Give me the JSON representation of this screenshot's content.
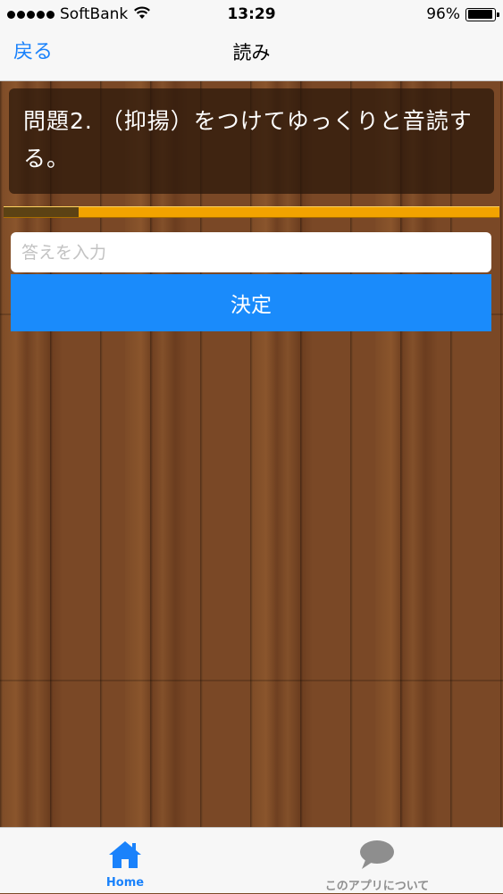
{
  "status_bar": {
    "carrier": "SoftBank",
    "time": "13:29",
    "battery": "96%",
    "battery_level": 0.96,
    "icons": [
      "signal-dots-icon",
      "wifi-icon",
      "battery-icon"
    ]
  },
  "nav": {
    "back_label": "戻る",
    "title": "読み"
  },
  "question": {
    "text": "問題2. （抑揚）をつけてゆっくりと音読する。"
  },
  "progress": {
    "fraction": 0.152
  },
  "answer": {
    "placeholder": "答えを入力",
    "value": ""
  },
  "submit": {
    "label": "決定"
  },
  "tabs": [
    {
      "label": "Home",
      "icon": "home-icon",
      "active": true
    },
    {
      "label": "このアプリについて",
      "icon": "speech-bubble-icon",
      "active": false
    }
  ],
  "colors": {
    "accent": "#1a82fb",
    "button": "#1a8bfb",
    "progress_track": "#f2a300",
    "progress_fill": "#5c4214",
    "tab_inactive": "#8e8e8e"
  }
}
